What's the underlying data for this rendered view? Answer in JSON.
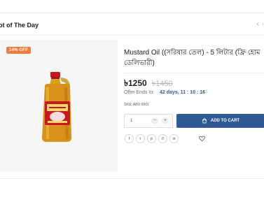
{
  "section": {
    "title": "ot of The Day",
    "prev_arrow": "‹",
    "next_arrow": "›"
  },
  "product": {
    "discount_badge": "14% OFF",
    "image_icon": "mustard-oil-bottle",
    "title": "Mustard Oil ((সরিষার তেল) - 5 লিটার (ফ্রি হোম ডেলিভারী)",
    "price_current": "৳1250",
    "price_original": "৳1450",
    "offer_label": "Offer Ends In:",
    "offer_time": "42 days, 11 : 10 : 16",
    "sku": "SKU: ABD-5001",
    "quantity": "1",
    "qty_minus": "−",
    "qty_plus": "+",
    "add_to_cart": "ADD TO CART"
  },
  "share": [
    {
      "icon": "facebook-icon",
      "glyph": "f"
    },
    {
      "icon": "twitter-icon",
      "glyph": "𝕥"
    },
    {
      "icon": "pinterest-icon",
      "glyph": "p"
    },
    {
      "icon": "whatsapp-icon",
      "glyph": "✆"
    },
    {
      "icon": "linkedin-icon",
      "glyph": "in"
    }
  ],
  "wishlist_icon": "heart-icon",
  "colors": {
    "accent": "#2f5a93",
    "badge": "#f47a3c",
    "image_bg": "#f6f6f6"
  }
}
